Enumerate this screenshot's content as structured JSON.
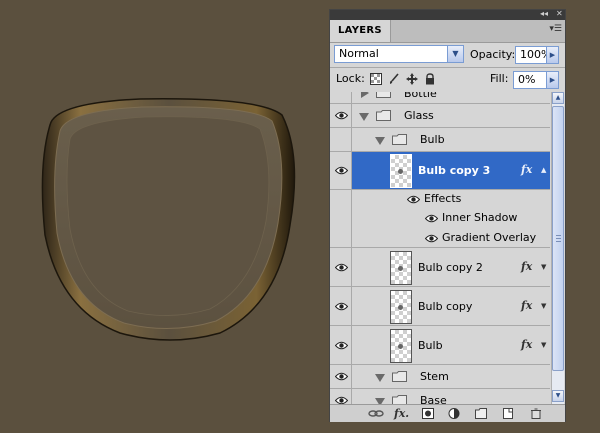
{
  "panel": {
    "tab_label": "LAYERS",
    "menu_icon": "panel-menu-icon",
    "blend_mode": "Normal",
    "opacity_label": "Opacity:",
    "opacity_value": "100%",
    "lock_label": "Lock:",
    "fill_label": "Fill:",
    "fill_value": "0%"
  },
  "layers": {
    "bottle": "Bottle",
    "glass": "Glass",
    "bulb_group": "Bulb",
    "bulb_copy3": "Bulb copy 3",
    "effects": "Effects",
    "inner_shadow": "Inner Shadow",
    "gradient_overlay": "Gradient Overlay",
    "bulb_copy2": "Bulb copy 2",
    "bulb_copy": "Bulb copy",
    "bulb": "Bulb",
    "stem": "Stem",
    "base": "Base"
  },
  "colors": {
    "canvas_bg": "#5b503e",
    "selection": "#3169c6",
    "panel_bg": "#d6d6d6"
  },
  "icons": [
    "eye-icon",
    "folder-icon",
    "fx-icon",
    "link-icon",
    "mask-icon",
    "adjustment-icon",
    "new-group-icon",
    "new-layer-icon",
    "trash-icon",
    "lock-icon",
    "brush-icon",
    "move-icon",
    "transparency-icon"
  ]
}
